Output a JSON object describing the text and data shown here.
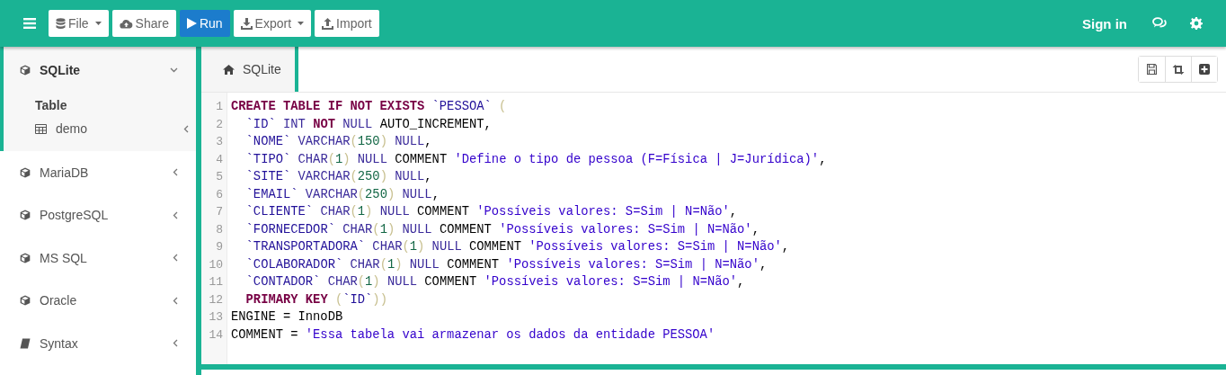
{
  "toolbar": {
    "buttons": [
      {
        "label": "File",
        "kind": "file",
        "dropdown": true,
        "primary": false
      },
      {
        "label": "Share",
        "kind": "share",
        "dropdown": false,
        "primary": false
      },
      {
        "label": "Run",
        "kind": "run",
        "dropdown": false,
        "primary": true
      },
      {
        "label": "Export",
        "kind": "export",
        "dropdown": true,
        "primary": false
      },
      {
        "label": "Import",
        "kind": "import",
        "dropdown": false,
        "primary": false
      }
    ],
    "sign_in": "Sign in"
  },
  "sidebar": {
    "items": [
      {
        "label": "SQLite",
        "kind": "database",
        "expanded": true,
        "children": [
          {
            "label": "Table",
            "kind": "heading"
          },
          {
            "label": "demo",
            "kind": "table",
            "expanded": false
          }
        ]
      },
      {
        "label": "MariaDB",
        "kind": "database",
        "expanded": false
      },
      {
        "label": "PostgreSQL",
        "kind": "database",
        "expanded": false
      },
      {
        "label": "MS SQL",
        "kind": "database",
        "expanded": false
      },
      {
        "label": "Oracle",
        "kind": "database",
        "expanded": false
      },
      {
        "label": "Syntax",
        "kind": "reference",
        "expanded": false
      }
    ]
  },
  "tabs": [
    {
      "label": "SQLite",
      "selected": true
    }
  ],
  "editor": {
    "lines": [
      {
        "number": "1",
        "indent": false,
        "tokens": [
          {
            "kind": "keyword",
            "text": "CREATE TABLE IF NOT EXISTS "
          },
          {
            "kind": "identifier",
            "text": "`PESSOA` "
          },
          {
            "kind": "bracket",
            "text": "("
          }
        ]
      },
      {
        "number": "2",
        "indent": true,
        "tokens": [
          {
            "kind": "identifier",
            "text": "`ID` "
          },
          {
            "kind": "type",
            "text": "INT "
          },
          {
            "kind": "keyword",
            "text": "NOT "
          },
          {
            "kind": "type",
            "text": "NULL "
          },
          {
            "kind": "plain",
            "text": "AUTO_INCREMENT,"
          }
        ]
      },
      {
        "number": "3",
        "indent": true,
        "tokens": [
          {
            "kind": "identifier",
            "text": "`NOME` "
          },
          {
            "kind": "type",
            "text": "VARCHAR"
          },
          {
            "kind": "bracket",
            "text": "("
          },
          {
            "kind": "number",
            "text": "150"
          },
          {
            "kind": "bracket",
            "text": ")"
          },
          {
            "kind": "type",
            "text": " NULL"
          },
          {
            "kind": "plain",
            "text": ","
          }
        ]
      },
      {
        "number": "4",
        "indent": true,
        "tokens": [
          {
            "kind": "identifier",
            "text": "`TIPO` "
          },
          {
            "kind": "type",
            "text": "CHAR"
          },
          {
            "kind": "bracket",
            "text": "("
          },
          {
            "kind": "number",
            "text": "1"
          },
          {
            "kind": "bracket",
            "text": ")"
          },
          {
            "kind": "type",
            "text": " NULL"
          },
          {
            "kind": "plain",
            "text": " COMMENT "
          },
          {
            "kind": "string",
            "text": "'Define o tipo de pessoa (F=Física | J=Jurídica)'"
          },
          {
            "kind": "plain",
            "text": ","
          }
        ]
      },
      {
        "number": "5",
        "indent": true,
        "tokens": [
          {
            "kind": "identifier",
            "text": "`SITE` "
          },
          {
            "kind": "type",
            "text": "VARCHAR"
          },
          {
            "kind": "bracket",
            "text": "("
          },
          {
            "kind": "number",
            "text": "250"
          },
          {
            "kind": "bracket",
            "text": ")"
          },
          {
            "kind": "type",
            "text": " NULL"
          },
          {
            "kind": "plain",
            "text": ","
          }
        ]
      },
      {
        "number": "6",
        "indent": true,
        "tokens": [
          {
            "kind": "identifier",
            "text": "`EMAIL` "
          },
          {
            "kind": "type",
            "text": "VARCHAR"
          },
          {
            "kind": "bracket",
            "text": "("
          },
          {
            "kind": "number",
            "text": "250"
          },
          {
            "kind": "bracket",
            "text": ")"
          },
          {
            "kind": "type",
            "text": " NULL"
          },
          {
            "kind": "plain",
            "text": ","
          }
        ]
      },
      {
        "number": "7",
        "indent": true,
        "tokens": [
          {
            "kind": "identifier",
            "text": "`CLIENTE` "
          },
          {
            "kind": "type",
            "text": "CHAR"
          },
          {
            "kind": "bracket",
            "text": "("
          },
          {
            "kind": "number",
            "text": "1"
          },
          {
            "kind": "bracket",
            "text": ")"
          },
          {
            "kind": "type",
            "text": " NULL"
          },
          {
            "kind": "plain",
            "text": " COMMENT "
          },
          {
            "kind": "string",
            "text": "'Possíveis valores: S=Sim | N=Não'"
          },
          {
            "kind": "plain",
            "text": ","
          }
        ]
      },
      {
        "number": "8",
        "indent": true,
        "tokens": [
          {
            "kind": "identifier",
            "text": "`FORNECEDOR` "
          },
          {
            "kind": "type",
            "text": "CHAR"
          },
          {
            "kind": "bracket",
            "text": "("
          },
          {
            "kind": "number",
            "text": "1"
          },
          {
            "kind": "bracket",
            "text": ")"
          },
          {
            "kind": "type",
            "text": " NULL"
          },
          {
            "kind": "plain",
            "text": " COMMENT "
          },
          {
            "kind": "string",
            "text": "'Possíveis valores: S=Sim | N=Não'"
          },
          {
            "kind": "plain",
            "text": ","
          }
        ]
      },
      {
        "number": "9",
        "indent": true,
        "tokens": [
          {
            "kind": "identifier",
            "text": "`TRANSPORTADORA` "
          },
          {
            "kind": "type",
            "text": "CHAR"
          },
          {
            "kind": "bracket",
            "text": "("
          },
          {
            "kind": "number",
            "text": "1"
          },
          {
            "kind": "bracket",
            "text": ")"
          },
          {
            "kind": "type",
            "text": " NULL"
          },
          {
            "kind": "plain",
            "text": " COMMENT "
          },
          {
            "kind": "string",
            "text": "'Possíveis valores: S=Sim | N=Não'"
          },
          {
            "kind": "plain",
            "text": ","
          }
        ]
      },
      {
        "number": "10",
        "indent": true,
        "tokens": [
          {
            "kind": "identifier",
            "text": "`COLABORADOR` "
          },
          {
            "kind": "type",
            "text": "CHAR"
          },
          {
            "kind": "bracket",
            "text": "("
          },
          {
            "kind": "number",
            "text": "1"
          },
          {
            "kind": "bracket",
            "text": ")"
          },
          {
            "kind": "type",
            "text": " NULL"
          },
          {
            "kind": "plain",
            "text": " COMMENT "
          },
          {
            "kind": "string",
            "text": "'Possíveis valores: S=Sim | N=Não'"
          },
          {
            "kind": "plain",
            "text": ","
          }
        ]
      },
      {
        "number": "11",
        "indent": true,
        "tokens": [
          {
            "kind": "identifier",
            "text": "`CONTADOR` "
          },
          {
            "kind": "type",
            "text": "CHAR"
          },
          {
            "kind": "bracket",
            "text": "("
          },
          {
            "kind": "number",
            "text": "1"
          },
          {
            "kind": "bracket",
            "text": ")"
          },
          {
            "kind": "type",
            "text": " NULL"
          },
          {
            "kind": "plain",
            "text": " COMMENT "
          },
          {
            "kind": "string",
            "text": "'Possíveis valores: S=Sim | N=Não'"
          },
          {
            "kind": "plain",
            "text": ","
          }
        ]
      },
      {
        "number": "12",
        "indent": true,
        "tokens": [
          {
            "kind": "keyword",
            "text": "PRIMARY KEY "
          },
          {
            "kind": "bracket",
            "text": "("
          },
          {
            "kind": "identifier",
            "text": "`ID`"
          },
          {
            "kind": "bracket",
            "text": "))"
          }
        ]
      },
      {
        "number": "13",
        "indent": false,
        "tokens": [
          {
            "kind": "plain",
            "text": "ENGINE = InnoDB"
          }
        ]
      },
      {
        "number": "14",
        "indent": false,
        "tokens": [
          {
            "kind": "plain",
            "text": "COMMENT = "
          },
          {
            "kind": "string",
            "text": "'Essa tabela vai armazenar os dados da entidade PESSOA'"
          }
        ]
      }
    ]
  }
}
